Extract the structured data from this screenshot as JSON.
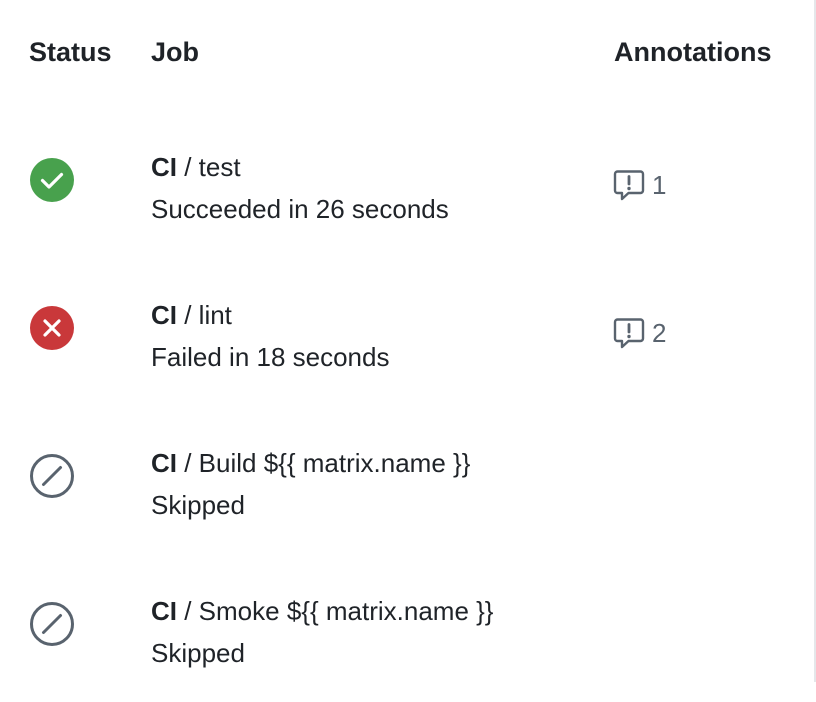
{
  "columns": {
    "status": "Status",
    "job": "Job",
    "annotations": "Annotations"
  },
  "jobs": [
    {
      "workflow": "CI",
      "separator": " / ",
      "name": "test",
      "detail": "Succeeded in 26 seconds",
      "status": "success",
      "status_icon": "check-circle-icon",
      "status_color": "#48a14d",
      "annotation_icon": "comment-alert-icon",
      "annotations": "1"
    },
    {
      "workflow": "CI",
      "separator": " / ",
      "name": "lint",
      "detail": "Failed in 18 seconds",
      "status": "failure",
      "status_icon": "x-circle-icon",
      "status_color": "#c9383a",
      "annotation_icon": "comment-alert-icon",
      "annotations": "2"
    },
    {
      "workflow": "CI",
      "separator": " / ",
      "name": "Build ${{ matrix.name }}",
      "detail": "Skipped",
      "status": "skipped",
      "status_icon": "skip-icon",
      "status_color": "#59636e"
    },
    {
      "workflow": "CI",
      "separator": " / ",
      "name": "Smoke ${{ matrix.name }}",
      "detail": "Skipped",
      "status": "skipped",
      "status_icon": "skip-icon",
      "status_color": "#59636e"
    }
  ]
}
